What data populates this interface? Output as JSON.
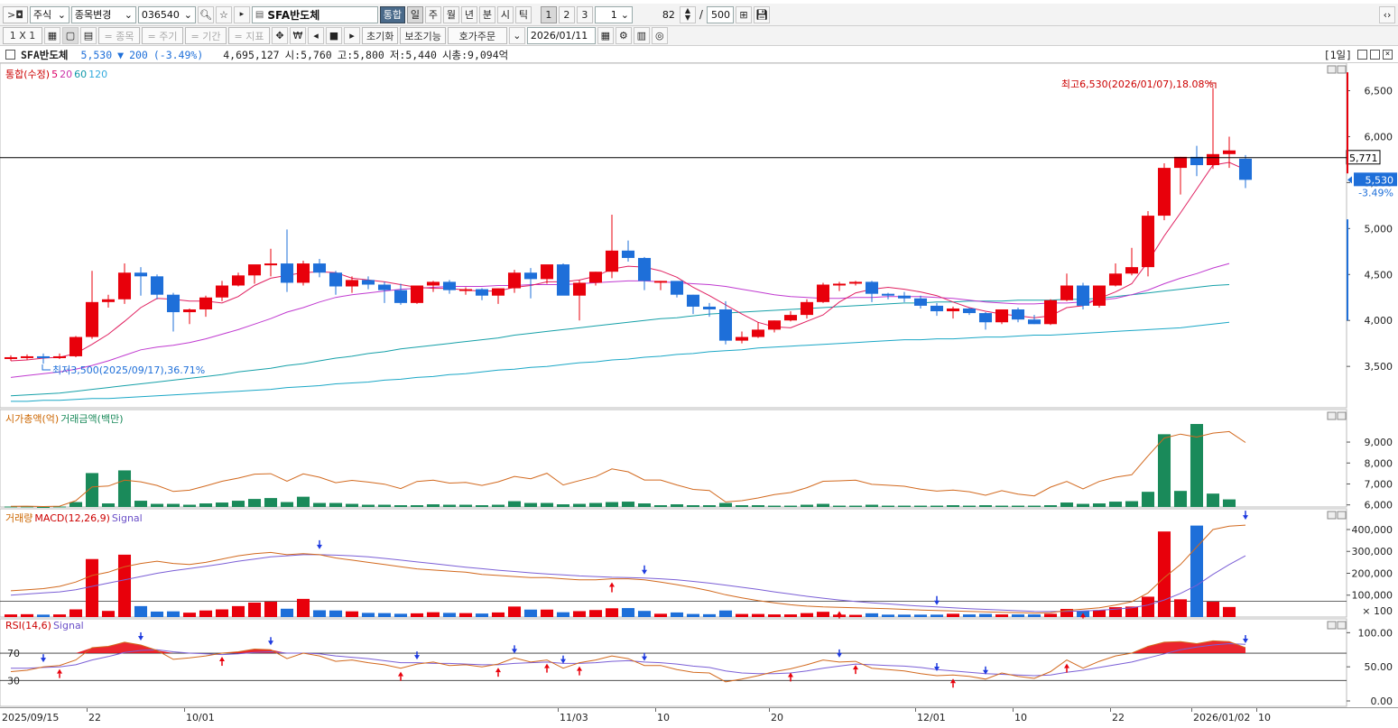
{
  "toolbar": {
    "expand_btn": ">◘",
    "market": "주식",
    "change_label": "종목변경",
    "code": "036540",
    "stock_name": "SFA반도체",
    "combined": "통합",
    "periods": [
      "일",
      "주",
      "월",
      "년",
      "분",
      "시",
      "틱"
    ],
    "nums": [
      "1",
      "2",
      "3"
    ],
    "interval": "1",
    "count": "82",
    "slash": "/",
    "total": "500",
    "layout": "1 X 1",
    "symbol_btn": "= 종목",
    "cycle_btn": "= 주기",
    "period_btn": "= 기간",
    "indicator_btn": "= 지표",
    "won": "₩",
    "reset": "초기화",
    "aux": "보조기능",
    "order": "호가주문",
    "date": "2026/01/11"
  },
  "info": {
    "name": "SFA반도체",
    "price": "5,530",
    "arrow": "▼",
    "change": "200",
    "pct": "(-3.49%)",
    "volume": "4,695,127",
    "open": "시:5,760",
    "high": "고:5,800",
    "low": "저:5,440",
    "cap": "시총:9,094억",
    "period_tag": "[1일]"
  },
  "main_panel": {
    "legend": [
      "통합(수정)",
      "5",
      "20",
      "60",
      "120"
    ],
    "legend_colors": [
      "#c00",
      "#d06",
      "#c3a",
      "#19a",
      "#3ad"
    ],
    "high_note": "최고6,530(2026/01/07),18.08%",
    "low_note": "최저3,500(2025/09/17),36.71%",
    "yticks": [
      "6,500",
      "6,000",
      "5,500",
      "5,000",
      "4,500",
      "4,000",
      "3,500"
    ],
    "crosshair_price": "5,771",
    "cur_price": "5,530",
    "cur_pct": "-3.49%"
  },
  "cap_panel": {
    "legend": [
      "시가총액(억)",
      "거래금액(백만)"
    ],
    "yticks": [
      "9,000",
      "8,000",
      "7,000",
      "6,000"
    ]
  },
  "vol_panel": {
    "legend": [
      "거래량",
      "MACD(12,26,9)",
      "Signal"
    ],
    "yticks": [
      "400,000",
      "300,000",
      "200,000",
      "100,000",
      "× 100"
    ]
  },
  "rsi_panel": {
    "legend": [
      "RSI(14,6)",
      "Signal"
    ],
    "yticks": [
      "100.00",
      "50.00",
      "0.00"
    ],
    "lines": [
      "70",
      "30"
    ]
  },
  "xaxis": [
    "2025/09/15",
    "22",
    "10/01",
    "11/03",
    "10",
    "20",
    "12/01",
    "10",
    "22",
    "2026/01/02",
    "10"
  ],
  "colors": {
    "up": "#e8000b",
    "down": "#1e6fd9",
    "cap": "#1a8a5a"
  },
  "chart_data": {
    "type": "candlestick",
    "candles": [
      [
        3590,
        3620,
        3560,
        3600
      ],
      [
        3600,
        3630,
        3570,
        3610
      ],
      [
        3610,
        3640,
        3530,
        3590
      ],
      [
        3590,
        3640,
        3580,
        3610
      ],
      [
        3610,
        3830,
        3600,
        3820
      ],
      [
        3820,
        4540,
        3800,
        4200
      ],
      [
        4200,
        4280,
        4140,
        4230
      ],
      [
        4230,
        4620,
        4180,
        4520
      ],
      [
        4520,
        4580,
        4270,
        4480
      ],
      [
        4480,
        4500,
        4230,
        4280
      ],
      [
        4280,
        4300,
        3880,
        4090
      ],
      [
        4090,
        4130,
        3960,
        4120
      ],
      [
        4120,
        4270,
        4040,
        4250
      ],
      [
        4250,
        4430,
        4210,
        4380
      ],
      [
        4380,
        4520,
        4370,
        4490
      ],
      [
        4490,
        4590,
        4400,
        4610
      ],
      [
        4600,
        4780,
        4480,
        4620
      ],
      [
        4620,
        4990,
        4310,
        4410
      ],
      [
        4410,
        4650,
        4380,
        4620
      ],
      [
        4620,
        4670,
        4470,
        4520
      ],
      [
        4520,
        4540,
        4280,
        4370
      ],
      [
        4370,
        4480,
        4300,
        4440
      ],
      [
        4440,
        4480,
        4340,
        4390
      ],
      [
        4390,
        4420,
        4190,
        4330
      ],
      [
        4330,
        4400,
        4170,
        4190
      ],
      [
        4190,
        4370,
        4180,
        4380
      ],
      [
        4380,
        4430,
        4310,
        4420
      ],
      [
        4420,
        4440,
        4290,
        4330
      ],
      [
        4330,
        4360,
        4280,
        4340
      ],
      [
        4340,
        4350,
        4220,
        4270
      ],
      [
        4270,
        4350,
        4180,
        4350
      ],
      [
        4350,
        4550,
        4300,
        4520
      ],
      [
        4520,
        4570,
        4240,
        4450
      ],
      [
        4450,
        4580,
        4400,
        4610
      ],
      [
        4610,
        4620,
        4280,
        4270
      ],
      [
        4270,
        4440,
        4000,
        4410
      ],
      [
        4410,
        4530,
        4380,
        4530
      ],
      [
        4530,
        5150,
        4460,
        4760
      ],
      [
        4760,
        4870,
        4640,
        4680
      ],
      [
        4680,
        4690,
        4330,
        4430
      ],
      [
        4430,
        4430,
        4330,
        4430
      ],
      [
        4430,
        4390,
        4250,
        4280
      ],
      [
        4280,
        4280,
        4070,
        4150
      ],
      [
        4150,
        4190,
        4040,
        4120
      ],
      [
        4120,
        4210,
        3740,
        3780
      ],
      [
        3780,
        3880,
        3750,
        3820
      ],
      [
        3820,
        3980,
        3810,
        3900
      ],
      [
        3900,
        4000,
        3870,
        4000
      ],
      [
        4000,
        4100,
        3990,
        4060
      ],
      [
        4060,
        4230,
        4020,
        4200
      ],
      [
        4200,
        4410,
        4190,
        4390
      ],
      [
        4390,
        4420,
        4320,
        4400
      ],
      [
        4400,
        4430,
        4380,
        4420
      ],
      [
        4420,
        4430,
        4200,
        4290
      ],
      [
        4290,
        4300,
        4230,
        4270
      ],
      [
        4270,
        4310,
        4200,
        4240
      ],
      [
        4240,
        4270,
        4130,
        4160
      ],
      [
        4160,
        4190,
        4050,
        4100
      ],
      [
        4100,
        4150,
        4020,
        4130
      ],
      [
        4130,
        4140,
        4060,
        4080
      ],
      [
        4080,
        4090,
        3900,
        3980
      ],
      [
        3980,
        4120,
        3960,
        4120
      ],
      [
        4120,
        4140,
        3980,
        4010
      ],
      [
        4010,
        4060,
        3960,
        3960
      ],
      [
        3960,
        4230,
        3950,
        4220
      ],
      [
        4220,
        4510,
        4210,
        4380
      ],
      [
        4380,
        4410,
        4120,
        4160
      ],
      [
        4160,
        4380,
        4140,
        4380
      ],
      [
        4380,
        4620,
        4370,
        4510
      ],
      [
        4510,
        4790,
        4490,
        4580
      ],
      [
        4580,
        5190,
        4480,
        5140
      ],
      [
        5140,
        5710,
        5090,
        5660
      ],
      [
        5660,
        5780,
        5370,
        5780
      ],
      [
        5780,
        5900,
        5570,
        5690
      ],
      [
        5690,
        6530,
        5650,
        5810
      ],
      [
        5810,
        6000,
        5660,
        5850
      ],
      [
        5760,
        5800,
        5440,
        5530
      ]
    ],
    "ma5": [
      3560,
      3570,
      3590,
      3600,
      3640,
      3740,
      3850,
      3990,
      4140,
      4240,
      4230,
      4210,
      4210,
      4190,
      4260,
      4380,
      4460,
      4490,
      4520,
      4530,
      4520,
      4460,
      4440,
      4420,
      4390,
      4360,
      4350,
      4350,
      4330,
      4320,
      4320,
      4360,
      4380,
      4420,
      4420,
      4440,
      4480,
      4560,
      4590,
      4580,
      4540,
      4470,
      4360,
      4270,
      4170,
      4070,
      3980,
      3930,
      3920,
      3990,
      4060,
      4200,
      4300,
      4340,
      4360,
      4340,
      4310,
      4270,
      4200,
      4140,
      4100,
      4070,
      4050,
      4030,
      4050,
      4140,
      4160,
      4240,
      4310,
      4400,
      4640,
      4920,
      5170,
      5430,
      5690,
      5720,
      5640
    ],
    "ma20": [
      3380,
      3400,
      3420,
      3440,
      3470,
      3510,
      3560,
      3620,
      3680,
      3710,
      3730,
      3760,
      3800,
      3850,
      3900,
      3960,
      4020,
      4090,
      4140,
      4200,
      4250,
      4280,
      4300,
      4320,
      4340,
      4350,
      4360,
      4370,
      4370,
      4370,
      4380,
      4380,
      4390,
      4390,
      4390,
      4400,
      4410,
      4420,
      4430,
      4430,
      4420,
      4410,
      4400,
      4390,
      4370,
      4340,
      4310,
      4280,
      4260,
      4250,
      4240,
      4240,
      4250,
      4250,
      4260,
      4260,
      4260,
      4250,
      4240,
      4220,
      4200,
      4190,
      4180,
      4180,
      4190,
      4190,
      4200,
      4220,
      4240,
      4280,
      4330,
      4400,
      4460,
      4510,
      4570,
      4620
    ],
    "ma60": [
      3180,
      3190,
      3200,
      3210,
      3230,
      3250,
      3270,
      3290,
      3310,
      3330,
      3350,
      3370,
      3390,
      3410,
      3440,
      3460,
      3480,
      3510,
      3530,
      3560,
      3590,
      3610,
      3640,
      3660,
      3690,
      3710,
      3730,
      3750,
      3770,
      3790,
      3810,
      3840,
      3860,
      3880,
      3900,
      3920,
      3940,
      3960,
      3980,
      4000,
      4020,
      4030,
      4050,
      4070,
      4080,
      4090,
      4100,
      4110,
      4120,
      4130,
      4140,
      4150,
      4160,
      4170,
      4180,
      4190,
      4190,
      4200,
      4200,
      4210,
      4210,
      4210,
      4220,
      4220,
      4220,
      4230,
      4230,
      4240,
      4260,
      4280,
      4300,
      4320,
      4340,
      4360,
      4380,
      4390
    ],
    "ma120": [
      3120,
      3120,
      3130,
      3130,
      3140,
      3150,
      3150,
      3160,
      3170,
      3180,
      3190,
      3200,
      3210,
      3220,
      3230,
      3240,
      3250,
      3270,
      3280,
      3290,
      3310,
      3320,
      3330,
      3350,
      3360,
      3380,
      3390,
      3410,
      3420,
      3440,
      3460,
      3470,
      3490,
      3500,
      3520,
      3540,
      3550,
      3570,
      3580,
      3600,
      3610,
      3630,
      3640,
      3660,
      3670,
      3680,
      3700,
      3710,
      3720,
      3730,
      3740,
      3750,
      3760,
      3770,
      3780,
      3790,
      3790,
      3800,
      3800,
      3810,
      3820,
      3820,
      3830,
      3840,
      3840,
      3850,
      3860,
      3870,
      3880,
      3890,
      3900,
      3910,
      3920,
      3940,
      3960,
      3980
    ],
    "cap": [
      5930,
      5940,
      5920,
      5940,
      6200,
      6860,
      6900,
      7180,
      7100,
      6930,
      6640,
      6700,
      6910,
      7130,
      7280,
      7470,
      7490,
      7130,
      7480,
      7320,
      7060,
      7170,
      7090,
      6990,
      6780,
      7120,
      7180,
      7040,
      7070,
      6930,
      7100,
      7360,
      7250,
      7510,
      6950,
      7160,
      7350,
      7720,
      7580,
      7190,
      7190,
      6950,
      6740,
      6690,
      6140,
      6200,
      6330,
      6490,
      6590,
      6820,
      7130,
      7150,
      7180,
      6980,
      6940,
      6890,
      6750,
      6660,
      6710,
      6630,
      6460,
      6680,
      6510,
      6430,
      6850,
      7120,
      6760,
      7120,
      7320,
      7440,
      8340,
      9190,
      9380,
      9240,
      9430,
      9500,
      8980
    ],
    "amount": [
      0.1,
      0.1,
      0.0,
      0.1,
      1.1,
      7.6,
      0.8,
      8.2,
      1.4,
      0.7,
      0.7,
      0.5,
      0.8,
      1.0,
      1.4,
      1.8,
      2.0,
      1.1,
      2.3,
      0.9,
      0.9,
      0.7,
      0.5,
      0.5,
      0.4,
      0.4,
      0.6,
      0.5,
      0.5,
      0.4,
      0.5,
      1.3,
      0.9,
      0.9,
      0.6,
      0.7,
      0.9,
      1.1,
      1.2,
      0.8,
      0.4,
      0.6,
      0.4,
      0.4,
      0.9,
      0.4,
      0.4,
      0.3,
      0.3,
      0.5,
      0.7,
      0.3,
      0.3,
      0.5,
      0.3,
      0.3,
      0.3,
      0.3,
      0.4,
      0.3,
      0.4,
      0.3,
      0.3,
      0.3,
      0.4,
      1.0,
      0.7,
      0.8,
      1.2,
      1.3,
      3.4,
      16.3,
      3.6,
      18.6,
      3.0,
      1.7
    ],
    "volume": [
      12,
      13,
      11,
      12,
      35,
      265,
      28,
      285,
      50,
      25,
      26,
      20,
      30,
      35,
      50,
      66,
      70,
      38,
      83,
      31,
      30,
      26,
      19,
      18,
      15,
      17,
      22,
      19,
      18,
      16,
      21,
      48,
      34,
      34,
      22,
      27,
      32,
      40,
      41,
      28,
      15,
      21,
      14,
      13,
      30,
      14,
      14,
      12,
      12,
      18,
      24,
      11,
      10,
      17,
      11,
      11,
      11,
      11,
      15,
      12,
      14,
      12,
      12,
      12,
      15,
      37,
      27,
      31,
      45,
      48,
      93,
      391,
      81,
      418,
      70,
      46
    ],
    "macd": [
      120,
      125,
      130,
      140,
      160,
      190,
      205,
      230,
      245,
      255,
      245,
      240,
      250,
      265,
      280,
      290,
      295,
      285,
      290,
      285,
      270,
      260,
      250,
      240,
      230,
      220,
      215,
      210,
      205,
      195,
      190,
      185,
      180,
      180,
      175,
      170,
      170,
      175,
      175,
      170,
      160,
      148,
      135,
      120,
      102,
      88,
      75,
      65,
      56,
      50,
      46,
      44,
      42,
      40,
      38,
      35,
      32,
      30,
      28,
      26,
      24,
      22,
      20,
      18,
      20,
      30,
      36,
      42,
      55,
      70,
      110,
      180,
      240,
      320,
      400,
      415,
      420
    ],
    "macd_signal": [
      100,
      105,
      110,
      115,
      125,
      140,
      155,
      170,
      185,
      200,
      212,
      222,
      232,
      243,
      255,
      265,
      275,
      280,
      285,
      285,
      283,
      280,
      275,
      268,
      260,
      252,
      244,
      236,
      228,
      221,
      214,
      208,
      202,
      197,
      193,
      188,
      185,
      182,
      180,
      178,
      175,
      170,
      163,
      155,
      146,
      136,
      126,
      115,
      105,
      95,
      86,
      78,
      71,
      65,
      60,
      55,
      50,
      46,
      42,
      38,
      35,
      32,
      29,
      26,
      25,
      26,
      28,
      31,
      36,
      42,
      55,
      78,
      108,
      145,
      195,
      240,
      280
    ],
    "rsi": [
      43,
      45,
      50,
      52,
      60,
      78,
      80,
      86,
      82,
      74,
      61,
      63,
      66,
      70,
      72,
      76,
      75,
      62,
      70,
      66,
      58,
      60,
      56,
      53,
      48,
      54,
      57,
      52,
      53,
      50,
      54,
      63,
      57,
      60,
      48,
      56,
      60,
      66,
      62,
      52,
      52,
      46,
      42,
      41,
      28,
      32,
      37,
      43,
      47,
      53,
      60,
      57,
      58,
      48,
      46,
      44,
      40,
      37,
      38,
      36,
      32,
      41,
      36,
      33,
      43,
      60,
      48,
      58,
      66,
      70,
      80,
      86,
      87,
      84,
      88,
      87,
      78
    ],
    "rsi_signal": [
      48,
      48,
      49,
      50,
      53,
      60,
      65,
      71,
      74,
      75,
      72,
      70,
      69,
      68,
      69,
      71,
      72,
      70,
      70,
      69,
      66,
      64,
      62,
      59,
      56,
      56,
      55,
      55,
      54,
      53,
      53,
      55,
      56,
      57,
      55,
      55,
      56,
      58,
      59,
      57,
      56,
      54,
      51,
      49,
      44,
      41,
      40,
      40,
      41,
      44,
      48,
      51,
      54,
      53,
      52,
      51,
      49,
      46,
      44,
      42,
      40,
      39,
      38,
      37,
      38,
      42,
      45,
      49,
      53,
      57,
      63,
      69,
      75,
      79,
      82,
      84,
      83
    ]
  }
}
